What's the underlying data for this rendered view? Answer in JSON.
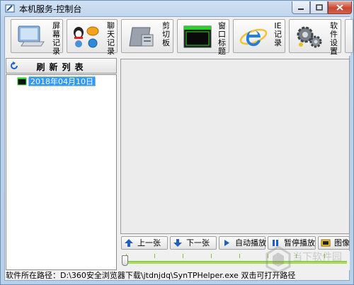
{
  "window": {
    "title": "本机服务-控制台",
    "controls": {
      "minimize": "minimize",
      "maximize": "maximize",
      "close": "close"
    }
  },
  "toolbar": {
    "buttons": [
      {
        "id": "screen-record",
        "label": "屏幕记录",
        "icon": "monitor-icon"
      },
      {
        "id": "chat-record",
        "label": "聊天记录",
        "icon": "chat-apps-icon"
      },
      {
        "id": "clipboard",
        "label": "剪切板",
        "icon": "clipboard-icon"
      },
      {
        "id": "window-title",
        "label": "窗口标题",
        "icon": "window-icon"
      },
      {
        "id": "ie-record",
        "label": "IE记录",
        "icon": "ie-icon"
      },
      {
        "id": "software-settings",
        "label": "软件设置",
        "icon": "gears-icon"
      }
    ]
  },
  "left_panel": {
    "refresh_label": "刷新列表",
    "tree": [
      {
        "label": "2018年04月10日",
        "selected": true
      }
    ]
  },
  "playback": {
    "prev_label": "上一张",
    "next_label": "下一张",
    "auto_play_label": "自动播放",
    "pause_label": "暂停播放",
    "image_label": "图像缩"
  },
  "timeline": {
    "position": 0
  },
  "statusbar": {
    "text": "软件所在路径：D:\\360安全浏览器下载\\jtdnjdq\\SynTPHelper.exe 双击可打开路径"
  },
  "watermark": {
    "text": "当下软件园"
  },
  "colors": {
    "selection": "#3399ff",
    "timeline": "#a5dd57",
    "accent_blue": "#1f5fbf"
  }
}
